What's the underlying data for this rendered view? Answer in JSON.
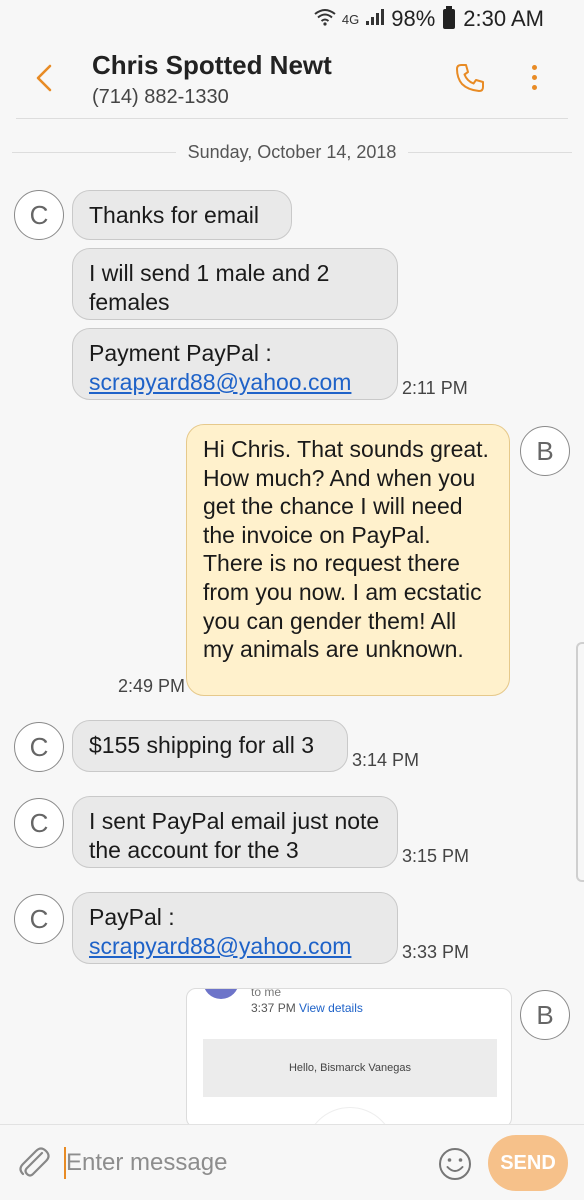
{
  "status_bar": {
    "network": "4G",
    "battery_level": "98%",
    "clock": "2:30 AM"
  },
  "header": {
    "contact_name": "Chris Spotted Newt",
    "phone_number": "(714) 882-1330",
    "back_icon": "chevron-left-icon",
    "call_icon": "phone-icon",
    "more_icon": "more-vertical-icon"
  },
  "date_divider": "Sunday, October 14, 2018",
  "messages": [
    {
      "direction": "incoming",
      "avatar": "C",
      "text": "Thanks for email"
    },
    {
      "direction": "incoming",
      "avatar": "C",
      "text": "I will send 1 male and 2 females"
    },
    {
      "direction": "incoming",
      "avatar": "C",
      "text_prefix": "Payment PayPal :",
      "link": "scrapyard88@yahoo.com",
      "time": "2:11 PM"
    },
    {
      "direction": "outgoing",
      "avatar": "B",
      "text": "Hi Chris. That sounds great. How much? And when you get the chance I will need the invoice on PayPal. There is no request there from you now. I am ecstatic you can gender them! All my animals are unknown.",
      "time": "2:49 PM"
    },
    {
      "direction": "incoming",
      "avatar": "C",
      "text": "$155 shipping for all 3",
      "time": "3:14 PM"
    },
    {
      "direction": "incoming",
      "avatar": "C",
      "text": "I sent PayPal email just note the account for the 3",
      "time": "3:15 PM"
    },
    {
      "direction": "incoming",
      "avatar": "C",
      "text_prefix": "PayPal :",
      "link": "scrapyard88@yahoo.com",
      "time": "3:33 PM"
    },
    {
      "direction": "outgoing",
      "avatar": "B",
      "type": "email-preview",
      "to_me": "to me",
      "sent_time": "3:37 PM",
      "view_details": "View details",
      "greeting": "Hello, Bismarck Vanegas"
    }
  ],
  "composer": {
    "placeholder": "Enter message",
    "send_label": "SEND",
    "attach_icon": "paperclip-icon",
    "emoji_icon": "smiley-icon"
  },
  "colors": {
    "accent": "#e88b25",
    "incoming_bubble": "#e9e9e9",
    "outgoing_bubble": "#fff1cc",
    "link": "#1e62c8",
    "send_disabled": "#f6c18a"
  }
}
